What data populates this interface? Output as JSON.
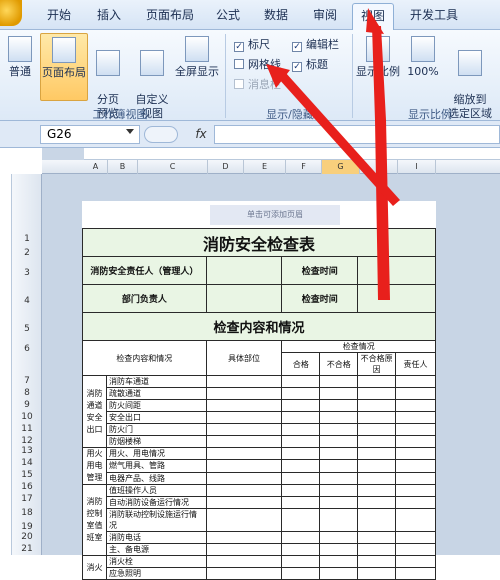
{
  "tabs": [
    "开始",
    "插入",
    "页面布局",
    "公式",
    "数据",
    "审阅",
    "视图",
    "开发工具"
  ],
  "active_tab": "视图",
  "ribbon": {
    "workbook_views": {
      "group_label": "工作簿视图",
      "buttons": [
        {
          "label": "普通",
          "selected": false
        },
        {
          "label": "页面布局",
          "selected": true
        },
        {
          "label": "分页\n预览",
          "selected": false
        },
        {
          "label": "自定义\n视图",
          "selected": false
        },
        {
          "label": "全屏显示",
          "selected": false
        }
      ]
    },
    "show_hide": {
      "group_label": "显示/隐藏",
      "checks": [
        {
          "label": "标尺",
          "checked": true,
          "disabled": false
        },
        {
          "label": "编辑栏",
          "checked": true,
          "disabled": false
        },
        {
          "label": "网格线",
          "checked": false,
          "disabled": false
        },
        {
          "label": "标题",
          "checked": true,
          "disabled": false
        },
        {
          "label": "消息栏",
          "checked": false,
          "disabled": true
        }
      ]
    },
    "zoom": {
      "group_label": "显示比例",
      "buttons": [
        {
          "label": "显示比例"
        },
        {
          "label": "100%"
        },
        {
          "label": "缩放到\n选定区域"
        }
      ]
    }
  },
  "formula_bar": {
    "name_box": "G26",
    "fx_label": "fx",
    "value": ""
  },
  "columns": [
    "A",
    "B",
    "C",
    "D",
    "E",
    "F",
    "G",
    "H",
    "I"
  ],
  "current_column": "G",
  "rows": [
    "1",
    "2",
    "3",
    "4",
    "5",
    "6",
    "7",
    "8",
    "9",
    "10",
    "11",
    "12",
    "13",
    "14",
    "15",
    "16",
    "17",
    "18",
    "19",
    "20",
    "21"
  ],
  "page_header_placeholder": "单击可添加页眉",
  "sheet": {
    "title": "消防安全检查表",
    "responsible_label": "消防安全责任人（管理人）",
    "check_time_label": "检查时间",
    "dept_head_label": "部门负责人",
    "content_title": "检查内容和情况",
    "col_content": "检查内容和情况",
    "col_location": "具体部位",
    "col_status": "检查情况",
    "col_pass": "合格",
    "col_fail": "不合格",
    "col_fail_reason": "不合格原因",
    "col_person": "责任人",
    "categories": [
      {
        "name": "消防通道安全出口",
        "items": [
          "消防车通道",
          "疏散通道",
          "防火间距",
          "安全出口",
          "防火门",
          "防烟楼梯"
        ]
      },
      {
        "name": "用火用电管理",
        "items": [
          "用火、用电情况",
          "燃气用具、管路",
          "电器产品、线路"
        ]
      },
      {
        "name": "消防控制室值班室",
        "items": [
          "值班操作人员",
          "自动消防设备运行情况",
          "消防联动控制设施运行情况",
          "消防电话",
          "主、备电源"
        ]
      },
      {
        "name": "消火",
        "items": [
          "消火栓",
          "应急照明"
        ]
      }
    ]
  }
}
